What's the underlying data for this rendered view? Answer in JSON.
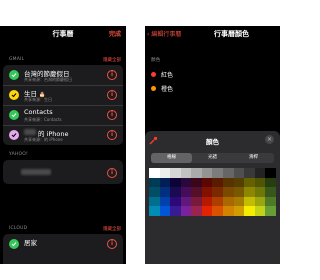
{
  "left": {
    "title": "行事曆",
    "done": "完成",
    "section_gmail": "GMAIL",
    "hide_all": "隱藏全部",
    "calendars": [
      {
        "name": "台灣的節慶假日",
        "sub": "共享來源：台灣的節慶假日",
        "color": "#34c759"
      },
      {
        "name": "生日",
        "sub": "共享來源：生日",
        "color": "#ffd60a"
      },
      {
        "name": "Contacts",
        "sub": "共享來源：Contacts",
        "color": "#34c759"
      },
      {
        "name": "的 iPhone",
        "sub": "共享來源：的 iPhone",
        "color": "#e5a9f0"
      }
    ],
    "section_yahoo": "YAHOO!",
    "section_icloud": "ICLOUD",
    "home_calendar": "居家"
  },
  "right": {
    "back": "編輯行事曆",
    "title": "行事曆顏色",
    "section": "顏色",
    "swatches": [
      {
        "label": "紅色",
        "color": "#ff3b30"
      },
      {
        "label": "橙色",
        "color": "#ff9500"
      }
    ],
    "sheet_title": "顏色",
    "tabs": [
      "格線",
      "光譜",
      "滑桿"
    ],
    "grid_colors": [
      [
        "#ffffff",
        "#ececec",
        "#d6d6d6",
        "#c1c1c1",
        "#aaaaaa",
        "#939393",
        "#7c7c7c",
        "#666666",
        "#4f4f4f",
        "#393939",
        "#232323",
        "#000000"
      ],
      [
        "#003b55",
        "#021e56",
        "#0c0436",
        "#2a0839",
        "#3c061a",
        "#5c0701",
        "#5a1c00",
        "#583300",
        "#563d00",
        "#666100",
        "#4f5504",
        "#263e0f"
      ],
      [
        "#004d65",
        "#012f7b",
        "#1a0a52",
        "#450d59",
        "#551029",
        "#821100",
        "#7b2900",
        "#7a4a00",
        "#785800",
        "#8d8602",
        "#6f760a",
        "#38571a"
      ],
      [
        "#016e8f",
        "#0042a9",
        "#2c0977",
        "#61187c",
        "#791a3d",
        "#b51a00",
        "#ad3e00",
        "#a96800",
        "#a67b01",
        "#c4bc00",
        "#9ba50e",
        "#4e7a27"
      ],
      [
        "#008cb4",
        "#0056d6",
        "#371a94",
        "#7a219e",
        "#99244f",
        "#e22400",
        "#da5100",
        "#d38301",
        "#d19d01",
        "#f5ec00",
        "#c3d117",
        "#669d34"
      ]
    ]
  }
}
